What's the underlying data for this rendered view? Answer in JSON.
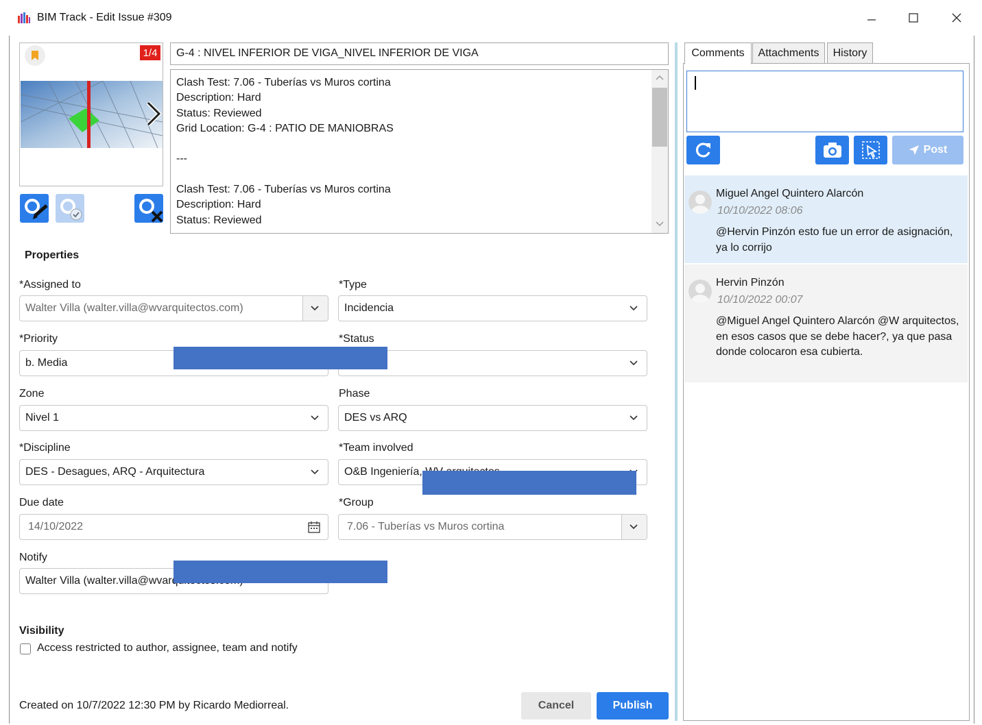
{
  "window": {
    "title": "BIM Track - Edit Issue #309"
  },
  "viewpoint": {
    "counter": "1/4"
  },
  "issue": {
    "title": "G-4 : NIVEL INFERIOR DE VIGA_NIVEL INFERIOR DE VIGA",
    "description_lines": [
      "Clash Test: 7.06 - Tuberías vs Muros cortina",
      "Description: Hard",
      "Status: Reviewed",
      "Grid Location: G-4 : PATIO DE MANIOBRAS",
      "",
      "---",
      "",
      "Clash Test: 7.06 - Tuberías vs Muros cortina",
      "Description: Hard",
      "Status: Reviewed"
    ]
  },
  "properties": {
    "heading": "Properties",
    "assigned_to": {
      "label": "*Assigned to",
      "value": "Walter Villa (walter.villa@wvarquitectos.com)"
    },
    "type": {
      "label": "*Type",
      "value": "Incidencia"
    },
    "priority": {
      "label": "*Priority",
      "value": "b. Media"
    },
    "status": {
      "label": "*Status",
      "value": ""
    },
    "zone": {
      "label": "Zone",
      "value": "Nivel 1"
    },
    "phase": {
      "label": "Phase",
      "value": "DES vs ARQ"
    },
    "discipline": {
      "label": "*Discipline",
      "value": "DES - Desagues, ARQ - Arquitectura"
    },
    "team": {
      "label": "*Team involved",
      "value": "O&B Ingeniería, WV arquitectos"
    },
    "due_date": {
      "label": "Due date",
      "value": "14/10/2022"
    },
    "group": {
      "label": "*Group",
      "value": "7.06 - Tuberías vs Muros cortina"
    },
    "notify": {
      "label": "Notify",
      "value": "Walter Villa (walter.villa@wvarquitectos.com)"
    }
  },
  "visibility": {
    "heading": "Visibility",
    "restricted_label": "Access restricted to author, assignee, team and notify",
    "restricted_checked": false
  },
  "footer": {
    "created": "Created on 10/7/2022 12:30 PM by Ricardo Mediorreal.",
    "cancel": "Cancel",
    "publish": "Publish"
  },
  "side": {
    "tabs": [
      "Comments",
      "Attachments",
      "History"
    ],
    "post_label": "Post",
    "comments": [
      {
        "author": "Miguel Angel Quintero Alarcón",
        "date": "10/10/2022 08:06",
        "text": "@Hervin Pinzón esto fue un error de asignación, ya lo corrijo"
      },
      {
        "author": "Hervin Pinzón",
        "date": "10/10/2022 00:07",
        "text": "@Miguel Angel Quintero Alarcón @W arquitectos, en esos casos que se debe hacer?, ya que pasa donde colocaron esa cubierta."
      }
    ]
  },
  "colors": {
    "accent": "#2b7de9",
    "post_disabled": "#9bbff0",
    "counter_badge": "#e0201b",
    "selected_comment_bg": "#e1eef9",
    "comment_bg": "#f3f3f3",
    "redaction": "#4472c4",
    "divider": "#b7dbe7"
  }
}
